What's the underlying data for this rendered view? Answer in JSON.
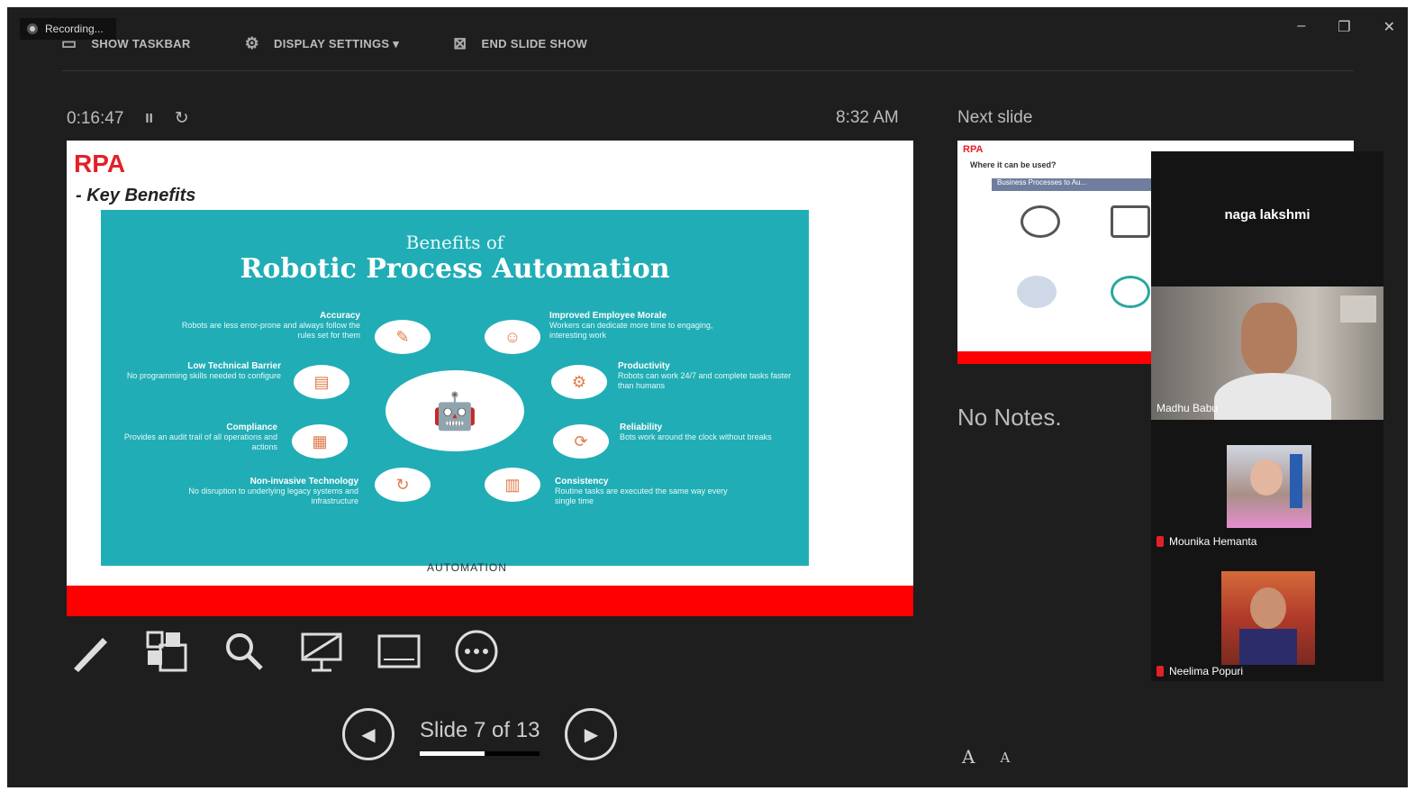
{
  "recording": {
    "label": "Recording..."
  },
  "toolbar": {
    "show_taskbar": "SHOW TASKBAR",
    "display_settings": "DISPLAY SETTINGS ▾",
    "end_slide_show": "END SLIDE SHOW"
  },
  "window_controls": {
    "minimize": "–",
    "restore": "❐",
    "close": "✕"
  },
  "presenter": {
    "elapsed": "0:16:47",
    "pause_symbol": "II",
    "reset_symbol": "↻",
    "clock": "8:32 AM",
    "next_slide_label": "Next slide",
    "notes": "No Notes.",
    "slide_label": "Slide 7 of 13",
    "slide_current": 7,
    "slide_total": 13,
    "font_increase": "A",
    "font_decrease": "A"
  },
  "current_slide": {
    "title": "RPA",
    "subtitle": "- Key Benefits",
    "infographic_title_1": "Benefits of",
    "infographic_title_2": "Robotic Process Automation",
    "footer_text": "AUTOMATION",
    "benefits_left": [
      {
        "name": "Accuracy",
        "desc": "Robots are less error-prone and always follow the rules set for them"
      },
      {
        "name": "Low Technical Barrier",
        "desc": "No programming skills needed to configure"
      },
      {
        "name": "Compliance",
        "desc": "Provides an audit trail of all operations and actions"
      },
      {
        "name": "Non-invasive Technology",
        "desc": "No disruption to underlying legacy systems and infrastructure"
      }
    ],
    "benefits_right": [
      {
        "name": "Improved Employee Morale",
        "desc": "Workers can dedicate more time to engaging, interesting work"
      },
      {
        "name": "Productivity",
        "desc": "Robots can work 24/7 and complete tasks faster than humans"
      },
      {
        "name": "Reliability",
        "desc": "Bots work around the clock without breaks"
      },
      {
        "name": "Consistency",
        "desc": "Routine tasks are executed the same way every single time"
      }
    ]
  },
  "next_slide_preview": {
    "title": "RPA",
    "question": "Where it can be used?",
    "band": "Business Processes to Au..."
  },
  "participants": [
    {
      "name": "naga lakshmi",
      "video": false
    },
    {
      "name": "Madhu Babu",
      "video": true
    },
    {
      "name": "Mounika Hemanta",
      "video": true
    },
    {
      "name": "Neelima Popuri",
      "video": true
    }
  ],
  "colors": {
    "accent_red": "#e3202a",
    "infographic_teal": "#21adb5",
    "background": "#1e1e1e"
  }
}
